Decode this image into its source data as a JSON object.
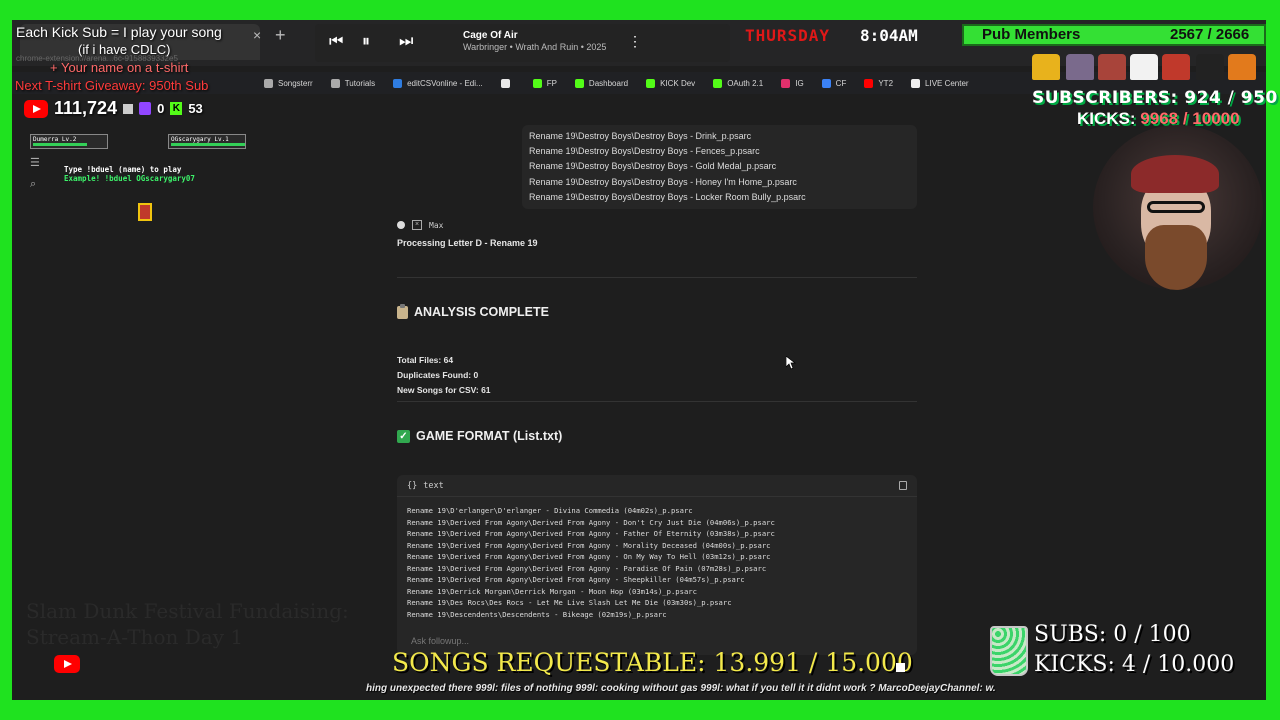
{
  "browser": {
    "address": "chrome-extension://arena...6c-9158839332e5",
    "bookmarks": [
      {
        "label": "Songsterr",
        "icon": "folder-icon",
        "color": "#aaaaaa"
      },
      {
        "label": "Tutorials",
        "icon": "folder-icon",
        "color": "#aaaaaa"
      },
      {
        "label": "editCSVonline - Edi...",
        "icon": "csv-icon",
        "color": "#2f7de1"
      },
      {
        "label": "",
        "icon": "chrome-icon",
        "color": "#e8e8e8"
      },
      {
        "label": "FP",
        "icon": "kick-icon",
        "color": "#53fc18"
      },
      {
        "label": "Dashboard",
        "icon": "kick-icon",
        "color": "#53fc18"
      },
      {
        "label": "KICK Dev",
        "icon": "kick-icon",
        "color": "#53fc18"
      },
      {
        "label": "OAuth 2.1",
        "icon": "kick-icon",
        "color": "#53fc18"
      },
      {
        "label": "IG",
        "icon": "instagram-icon",
        "color": "#e1306c"
      },
      {
        "label": "CF",
        "icon": "cf-icon",
        "color": "#3b82f6"
      },
      {
        "label": "YT2",
        "icon": "youtube-icon",
        "color": "#ff0000"
      },
      {
        "label": "LIVE Center",
        "icon": "tiktok-icon",
        "color": "#eeeeee"
      }
    ]
  },
  "files": [
    "Rename 19\\Destroy Boys\\Destroy Boys - Drink_p.psarc",
    "Rename 19\\Destroy Boys\\Destroy Boys - Fences_p.psarc",
    "Rename 19\\Destroy Boys\\Destroy Boys - Gold Medal_p.psarc",
    "Rename 19\\Destroy Boys\\Destroy Boys - Honey I'm Home_p.psarc",
    "Rename 19\\Destroy Boys\\Destroy Boys - Locker Room Bully_p.psarc"
  ],
  "processing": {
    "user": "Max",
    "line": "Processing Letter D - Rename 19"
  },
  "analysis": {
    "title": "ANALYSIS COMPLETE",
    "total_files": "Total Files: 64",
    "duplicates": "Duplicates Found: 0",
    "new_songs": "New Songs for CSV: 61"
  },
  "game_format": {
    "title": "GAME FORMAT (List.txt)",
    "lang": "text",
    "lines": [
      "Rename 19\\D'erlanger\\D'erlanger - Divina Commedia (04m02s)_p.psarc",
      "Rename 19\\Derived From Agony\\Derived From Agony - Don't Cry Just Die (04m06s)_p.psarc",
      "Rename 19\\Derived From Agony\\Derived From Agony - Father Of Eternity (03m38s)_p.psarc",
      "Rename 19\\Derived From Agony\\Derived From Agony - Morality Deceased (04m00s)_p.psarc",
      "Rename 19\\Derived From Agony\\Derived From Agony - On My Way To Hell (03m12s)_p.psarc",
      "Rename 19\\Derived From Agony\\Derived From Agony - Paradise Of Pain (07m28s)_p.psarc",
      "Rename 19\\Derived From Agony\\Derived From Agony - Sheepkiller (04m57s)_p.psarc",
      "Rename 19\\Derrick Morgan\\Derrick Morgan - Moon Hop (03m14s)_p.psarc",
      "Rename 19\\Des Rocs\\Des Rocs - Let Me Live Slash Let Me Die (03m30s)_p.psarc",
      "Rename 19\\Descendents\\Descendents - Bikeage (02m19s)_p.psarc"
    ],
    "followup_placeholder": "Ask followup..."
  },
  "overlay": {
    "kick_sub_line1": "Each Kick Sub = I play your song",
    "kick_sub_line2": "(if i have CDLC)",
    "kick_sub_line3": "+ Your name on a t-shirt",
    "kick_sub_line4": "Next T-shirt Giveaway: 950th Sub",
    "yt_count": "111,724",
    "ig_count": "0",
    "kick_count": "53",
    "duel_player1": "Dumerra  Lv.2",
    "duel_player2": "OGscarygary Lv.1",
    "duel_line1": "Type !bduel (name) to play",
    "duel_line2": "Example! !bduel OGscarygary07",
    "song_title": "Cage Of Air",
    "song_artist": "Warbringer • Wrath And Ruin • 2025",
    "weekday": "THURSDAY",
    "time": "8:04AM",
    "pub_label": "Pub Members",
    "pub_count": "2567 / 2666",
    "subs_top_label": "SUBSCRIBERS:",
    "subs_top_value": "924 / 950",
    "kicks_top_label": "KICKS:",
    "kicks_top_value": "9968 / 10000",
    "fundraising_line1": "Slam Dunk Festival Fundaising:",
    "fundraising_line2": "Stream-A-Thon Day 1",
    "songs_requestable": "SONGS REQUESTABLE: 13.991 / 15.000",
    "ticker": "hing unexpected there  999l: files of nothing  999l: cooking without gas  999l: what if you tell it it didnt work ?  MarcoDeejayChannel:  w.",
    "subs_bottom": "SUBS:  0 / 100",
    "kicks_bottom": "KICKS: 4 / 10.000"
  }
}
